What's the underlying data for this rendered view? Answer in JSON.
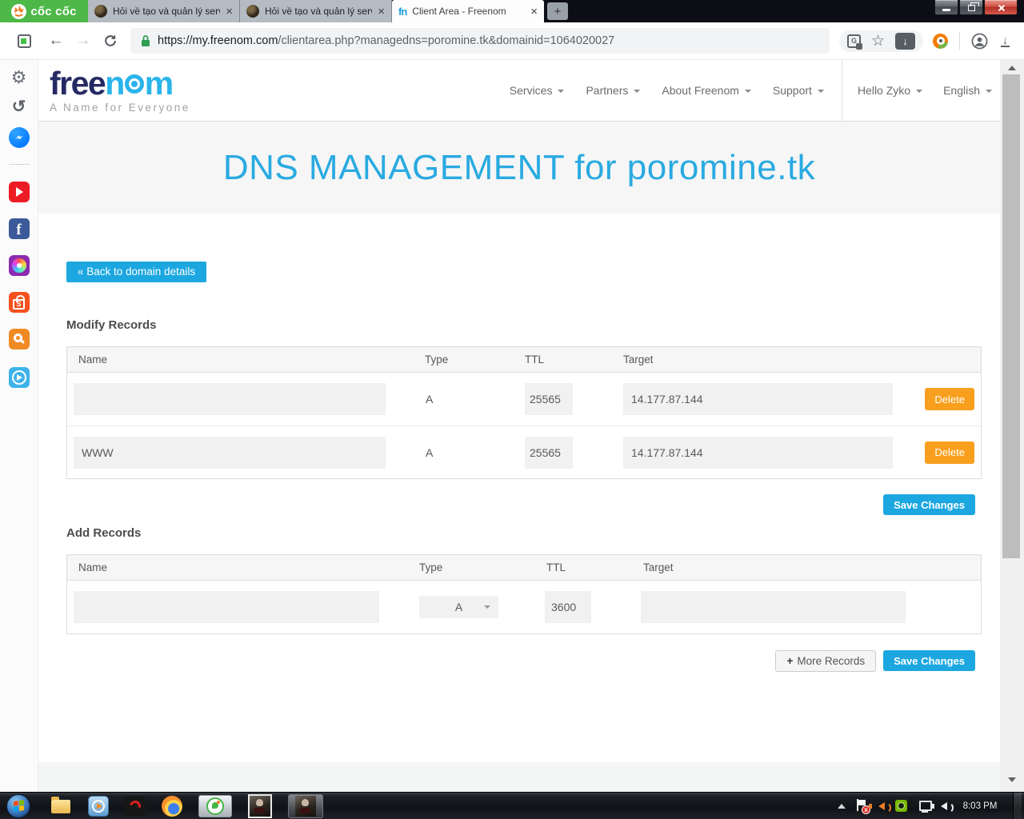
{
  "browser": {
    "brand": "cốc cốc",
    "tabs": [
      {
        "title": "Hỏi về tạo và quản lý serv"
      },
      {
        "title": "Hỏi về tạo và quản lý serv"
      },
      {
        "title": "Client Area - Freenom",
        "favicon_text": "fn"
      }
    ],
    "close_glyph": "×",
    "new_tab_glyph": "+",
    "url_host": "https://my.freenom.com",
    "url_path": "/clientarea.php?managedns=poromine.tk&domainid=1064020027",
    "translate_hint": "G"
  },
  "site": {
    "logo": {
      "pre": "free",
      "n": "n",
      "m": "m",
      "tagline": "A Name for Everyone"
    },
    "nav": [
      {
        "label": "Services"
      },
      {
        "label": "Partners"
      },
      {
        "label": "About Freenom"
      },
      {
        "label": "Support"
      }
    ],
    "user": {
      "greeting": "Hello Zyko",
      "language": "English"
    },
    "hero": {
      "title": "DNS MANAGEMENT for poromine.tk"
    },
    "back_button": "« Back to domain details",
    "modify": {
      "heading": "Modify Records",
      "columns": {
        "name": "Name",
        "type": "Type",
        "ttl": "TTL",
        "target": "Target"
      },
      "rows": [
        {
          "name": "",
          "type": "A",
          "ttl": "25565",
          "target": "14.177.87.144",
          "action": "Delete"
        },
        {
          "name": "WWW",
          "type": "A",
          "ttl": "25565",
          "target": "14.177.87.144",
          "action": "Delete"
        }
      ],
      "save": "Save Changes"
    },
    "add": {
      "heading": "Add Records",
      "columns": {
        "name": "Name",
        "type": "Type",
        "ttl": "TTL",
        "target": "Target"
      },
      "row": {
        "name": "",
        "type": "A",
        "ttl": "3600",
        "target": ""
      },
      "more_plus": "+",
      "more": "More Records",
      "save": "Save Changes"
    }
  },
  "taskbar": {
    "clock": "8:03 PM"
  }
}
